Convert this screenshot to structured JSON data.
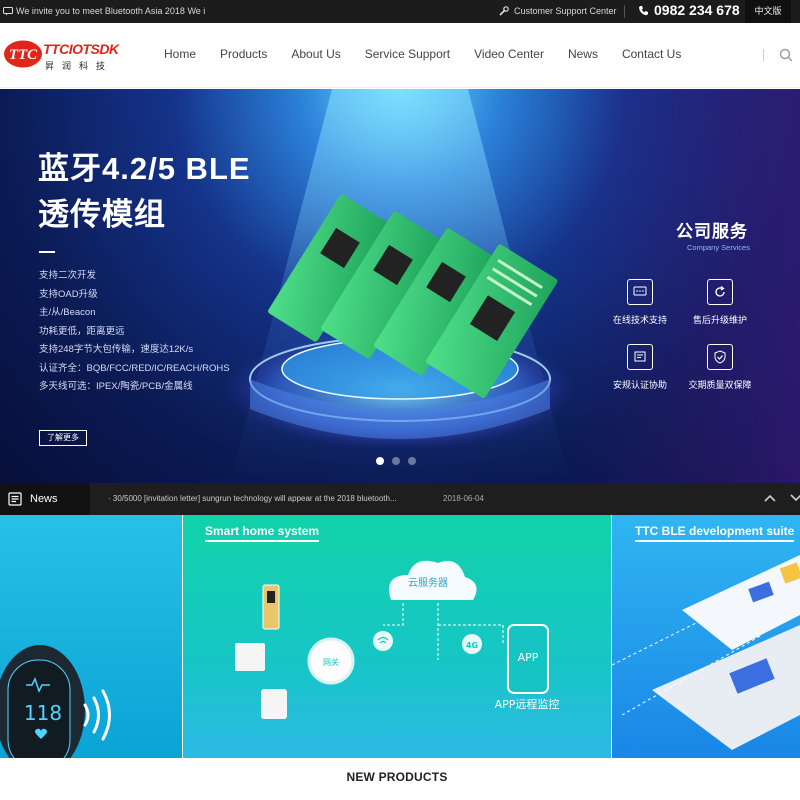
{
  "topbar": {
    "notice": "We invite you to meet Bluetooth Asia 2018 We i",
    "support_label": "Customer Support Center",
    "phone": "0982 234 678",
    "language": "中文版"
  },
  "brand": {
    "name": "TTCIOTSDK",
    "chinese_name": "昇润科技",
    "logo_letters": "TTC",
    "color": "#e0261b"
  },
  "nav": {
    "items": [
      {
        "label": "Home"
      },
      {
        "label": "Products"
      },
      {
        "label": "About Us"
      },
      {
        "label": "Service Support"
      },
      {
        "label": "Video Center"
      },
      {
        "label": "News"
      },
      {
        "label": "Contact Us"
      }
    ],
    "search_icon": "search-icon"
  },
  "banner": {
    "title_line1": "蓝牙4.2/5 BLE",
    "title_line2": "透传模组",
    "features": [
      "支持二次开发",
      "支持OAD升级",
      "主/从/Beacon",
      "功耗更低，距离更远",
      "支持248字节大包传输，速度达12K/s",
      "认证齐全：BQB/FCC/RED/IC/REACH/ROHS",
      "多天线可选：IPEX/陶瓷/PCB/金属线"
    ],
    "more_button": "了解更多",
    "services_title": "公司服务",
    "services_subtitle": "Company Services",
    "services": [
      {
        "label": "在线技术支持",
        "icon": "chat-icon"
      },
      {
        "label": "售后升级维护",
        "icon": "refresh-icon"
      },
      {
        "label": "安规认证协助",
        "icon": "certificate-icon"
      },
      {
        "label": "交期质量双保障",
        "icon": "shield-check-icon"
      }
    ],
    "slides": {
      "count": 3,
      "active": 1
    }
  },
  "news": {
    "label": "News",
    "headline": "30/5000 [invitation letter] sungrun technology will appear at the 2018 bluetooth...",
    "date": "2018-06-04"
  },
  "cards": [
    {
      "title": "",
      "watch_value": "118"
    },
    {
      "title": "Smart home system",
      "cloud_label": "云服务器",
      "gateway_label": "网关",
      "signal_label": "4G",
      "app_label": "APP",
      "app_caption": "APP远程监控"
    },
    {
      "title": "TTC BLE development suite"
    }
  ],
  "products_section": {
    "title": "NEW PRODUCTS"
  }
}
